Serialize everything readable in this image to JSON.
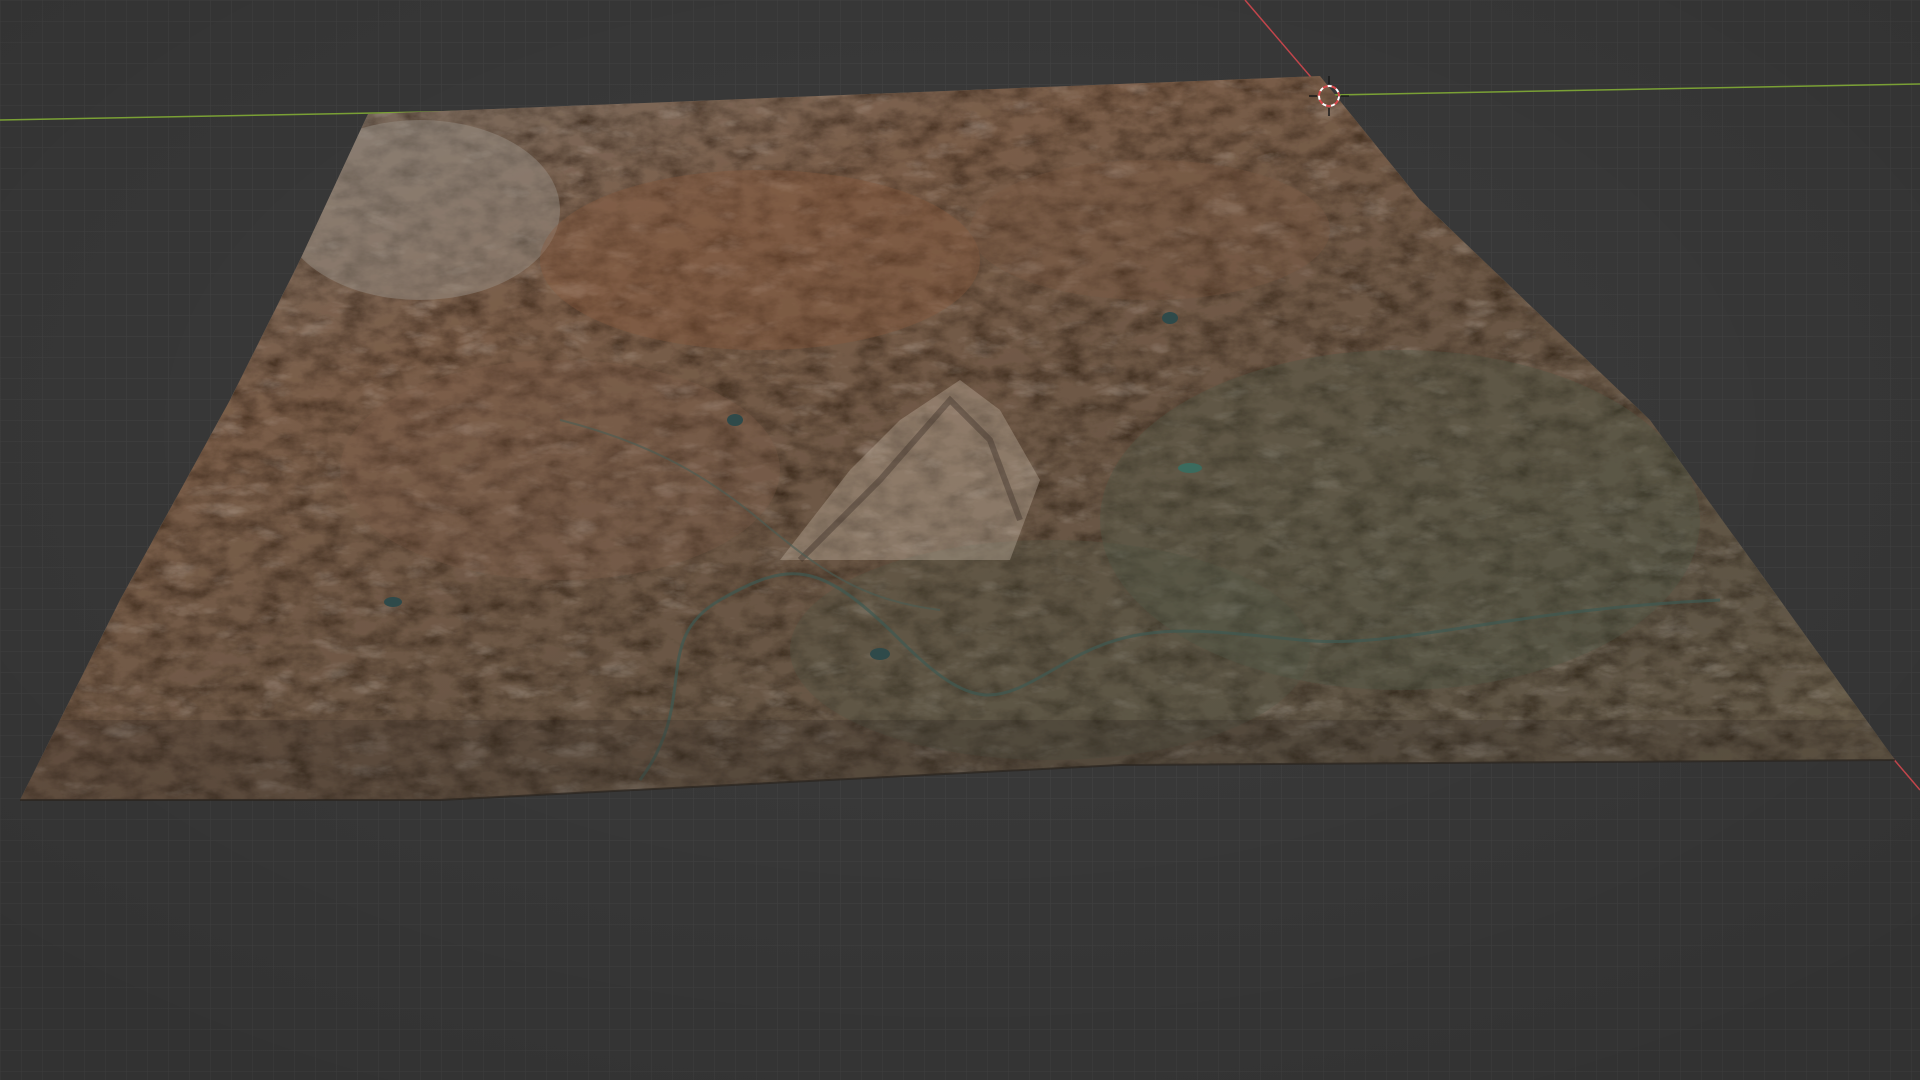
{
  "viewport": {
    "background": "#3d3d3d",
    "grid_color": "#4a4a4a",
    "x_axis_color": "#c2454b",
    "y_axis_color": "#7aa035"
  },
  "scene": {
    "object": "terrain-mesh",
    "icons": {
      "cursor": "3d-cursor-icon"
    }
  }
}
